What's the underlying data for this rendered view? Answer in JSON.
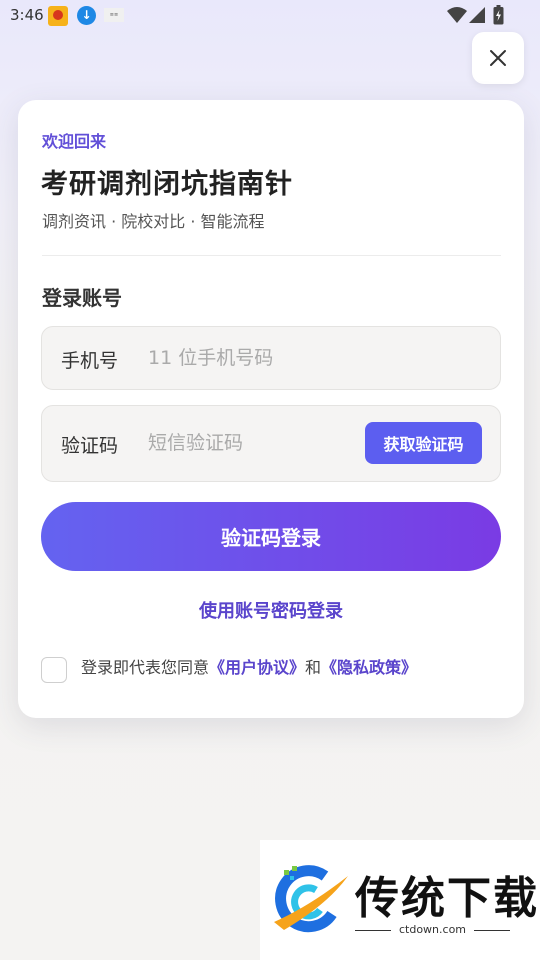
{
  "status_bar": {
    "time": "3:46",
    "icons": [
      "app-notification-icon",
      "download-icon",
      "app-icon",
      "wifi-icon",
      "signal-icon",
      "battery-icon"
    ]
  },
  "close_label": "×",
  "card": {
    "welcome": "欢迎回来",
    "title": "考研调剂闭坑指南针",
    "subtitle": "调剂资讯 · 院校对比 · 智能流程",
    "section_title": "登录账号",
    "phone_field": {
      "label": "手机号",
      "placeholder": "11 位手机号码",
      "value": ""
    },
    "code_field": {
      "label": "验证码",
      "placeholder": "短信验证码",
      "value": "",
      "get_code_label": "获取验证码"
    },
    "login_button": "验证码登录",
    "password_login_link": "使用账号密码登录",
    "agreement": {
      "checked": false,
      "prefix": "登录即代表您同意",
      "user_agreement": "《用户协议》",
      "conjunction": "和",
      "privacy_policy": "《隐私政策》"
    }
  },
  "watermark": {
    "brand": "传统下载",
    "url": "ctdown.com"
  },
  "colors": {
    "accent": "#5c5ef0",
    "accent_purple": "#7a3be4",
    "link": "#5a45cc"
  }
}
